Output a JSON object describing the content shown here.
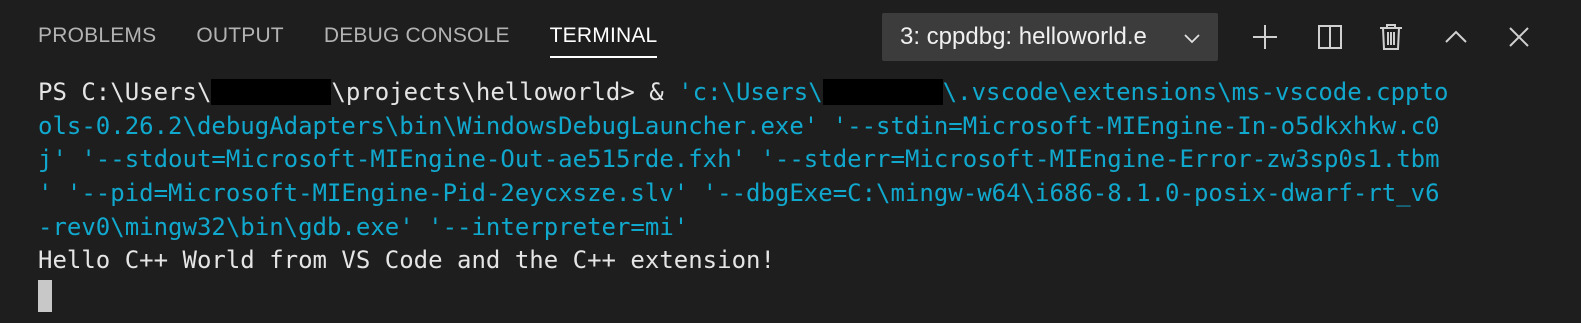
{
  "tabs": [
    {
      "label": "PROBLEMS",
      "active": false
    },
    {
      "label": "OUTPUT",
      "active": false
    },
    {
      "label": "DEBUG CONSOLE",
      "active": false
    },
    {
      "label": "TERMINAL",
      "active": true
    }
  ],
  "terminal_select": {
    "value": "3: cppdbg: helloworld.e",
    "icon": "chevron-down-icon"
  },
  "actions": [
    {
      "name": "new-terminal",
      "icon": "plus-icon"
    },
    {
      "name": "split-terminal",
      "icon": "split-icon"
    },
    {
      "name": "kill-terminal",
      "icon": "trash-icon"
    },
    {
      "name": "maximize-panel",
      "icon": "chevron-up-icon"
    },
    {
      "name": "close-panel",
      "icon": "close-icon"
    }
  ],
  "terminal": {
    "prompt_prefix": "PS C:\\Users\\",
    "prompt_suffix": "\\projects\\helloworld> & ",
    "cmd_part1": "'c:\\Users\\",
    "cmd_part2": "\\.vscode\\extensions\\ms-vscode.cppto",
    "line2": "ols-0.26.2\\debugAdapters\\bin\\WindowsDebugLauncher.exe' '--stdin=Microsoft-MIEngine-In-o5dkxhkw.c0",
    "line3": "j' '--stdout=Microsoft-MIEngine-Out-ae515rde.fxh' '--stderr=Microsoft-MIEngine-Error-zw3sp0s1.tbm",
    "line4": "' '--pid=Microsoft-MIEngine-Pid-2eycxsze.slv' '--dbgExe=C:\\mingw-w64\\i686-8.1.0-posix-dwarf-rt_v6",
    "line5": "-rev0\\mingw32\\bin\\gdb.exe' '--interpreter=mi'",
    "output": "Hello C++ World from VS Code and the C++ extension!"
  },
  "colors": {
    "background": "#1e1e1e",
    "command": "#11a8cd",
    "text": "#cccccc",
    "select_bg": "#3c3c3c"
  }
}
